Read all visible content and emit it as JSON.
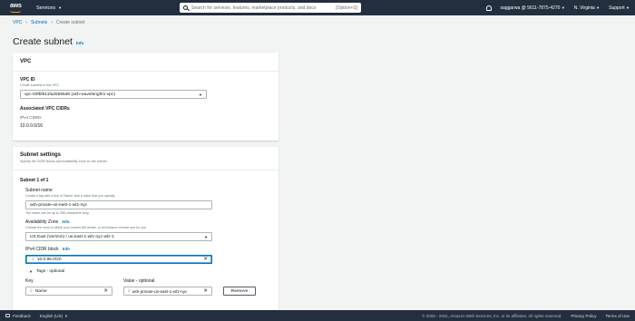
{
  "topnav": {
    "logo": "aws",
    "services_label": "Services",
    "search_placeholder": "Search for services, features, marketplace products, and docs",
    "search_shortcut": "[Option+S]",
    "account": "saggarwa @ 5611-7875-4270",
    "region": "N. Virginia",
    "support": "Support"
  },
  "breadcrumb": [
    "VPC",
    "Subnets",
    "Create subnet"
  ],
  "page": {
    "title": "Create subnet",
    "info": "Info"
  },
  "vpc_panel": {
    "title": "VPC",
    "vpc_id_label": "VPC ID",
    "vpc_id_desc": "Create subnets in this VPC.",
    "vpc_id_value": "vpc-00fbf511fa25556d6 (ash-wavelength1-vpc)",
    "cidrs_label": "Associated VPC CIDRs",
    "ipv4_label": "IPv4 CIDRs",
    "ipv4_value": "10.0.0.0/16"
  },
  "subnet_panel": {
    "title": "Subnet settings",
    "desc": "Specify the CIDR blocks and Availability Zone for the subnet.",
    "subnet_index": "Subnet 1 of 1",
    "name_label": "Subnet name",
    "name_desc": "Create a tag with a key of 'Name' and a value that you specify.",
    "name_value": "ash-private-us-east-1-wl1-nyc",
    "name_hint": "The name can be up to 256 characters long.",
    "az_label": "Availability Zone",
    "az_info": "Info",
    "az_desc": "Choose the zone in which your subnet will reside, or let Amazon choose one for you.",
    "az_value": "US East (Verizon) / us-east-1-wl1-nyc-wlz-1",
    "cidr_label": "IPv4 CIDR block",
    "cidr_info": "Info",
    "cidr_value": "10.0.96.0/20",
    "tags_label": "Tags - optional",
    "key_label": "Key",
    "value_label": "Value - optional",
    "key_value": "Name",
    "tag_value": "ash-private-us-east-1-wl1-nyc",
    "remove_label": "Remove"
  },
  "footer": {
    "feedback": "Feedback",
    "language": "English (US)",
    "copyright": "© 2008 - 2021, Amazon Web Services, Inc. or its affiliates. All rights reserved.",
    "privacy": "Privacy Policy",
    "terms": "Terms of Use"
  }
}
